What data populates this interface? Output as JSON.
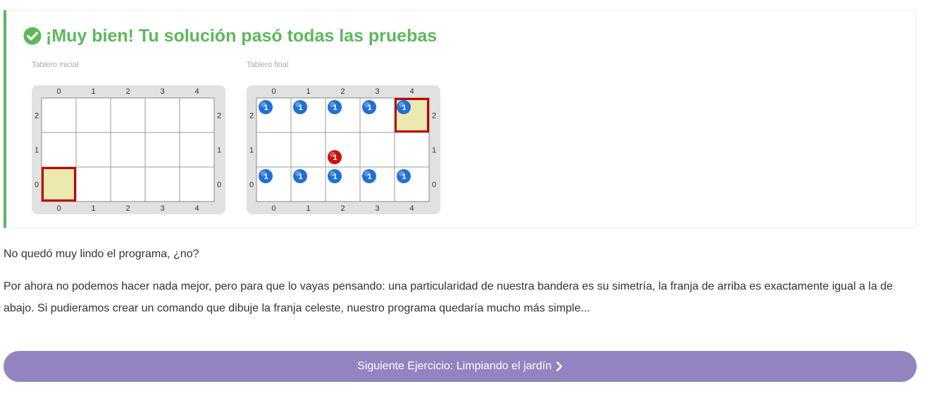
{
  "result": {
    "title": "¡Muy bien! Tu solución pasó todas las pruebas",
    "success_color": "#5cb85c"
  },
  "boards": [
    {
      "id": "initial",
      "caption": "Tablero inicial",
      "columns": [
        "0",
        "1",
        "2",
        "3",
        "4"
      ],
      "rows": [
        "2",
        "1",
        "0"
      ],
      "head": {
        "x": 0,
        "y": 0
      },
      "balls": []
    },
    {
      "id": "final",
      "caption": "Tablero final",
      "columns": [
        "0",
        "1",
        "2",
        "3",
        "4"
      ],
      "rows": [
        "2",
        "1",
        "0"
      ],
      "head": {
        "x": 4,
        "y": 2
      },
      "balls": [
        {
          "x": 0,
          "y": 2,
          "color": "blue",
          "count": "1"
        },
        {
          "x": 1,
          "y": 2,
          "color": "blue",
          "count": "1"
        },
        {
          "x": 2,
          "y": 2,
          "color": "blue",
          "count": "1"
        },
        {
          "x": 3,
          "y": 2,
          "color": "blue",
          "count": "1"
        },
        {
          "x": 4,
          "y": 2,
          "color": "blue",
          "count": "1"
        },
        {
          "x": 2,
          "y": 1,
          "color": "red",
          "count": "1"
        },
        {
          "x": 0,
          "y": 0,
          "color": "blue",
          "count": "1"
        },
        {
          "x": 1,
          "y": 0,
          "color": "blue",
          "count": "1"
        },
        {
          "x": 2,
          "y": 0,
          "color": "blue",
          "count": "1"
        },
        {
          "x": 3,
          "y": 0,
          "color": "blue",
          "count": "1"
        },
        {
          "x": 4,
          "y": 0,
          "color": "blue",
          "count": "1"
        }
      ]
    }
  ],
  "ball_colors": {
    "blue": "#1f6fd6",
    "red": "#cc1010"
  },
  "head_fill": "#ebe8b0",
  "head_border": "#c00000",
  "paragraphs": [
    "No quedó muy lindo el programa, ¿no?",
    "Por ahora no podemos hacer nada mejor, pero para que lo vayas pensando: una particularidad de nuestra bandera es su simetría, la franja de arriba es exactamente igual a la de abajo. Si pudieramos crear un comando que dibuje la franja celeste, nuestro programa quedaría mucho más simple..."
  ],
  "next_button": {
    "label": "Siguiente Ejercicio: Limpiando el jardín",
    "icon": "chevron-right-icon",
    "color": "#9384c0"
  }
}
